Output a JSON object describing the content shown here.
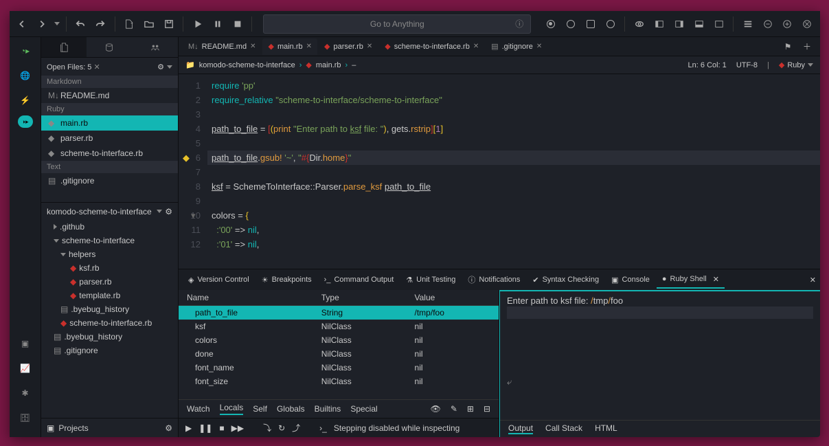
{
  "search_placeholder": "Go to Anything",
  "status": {
    "line_col": "Ln: 6 Col: 1",
    "encoding": "UTF-8",
    "language": "Ruby"
  },
  "tabs": [
    {
      "label": "README.md",
      "icon": "markdown"
    },
    {
      "label": "main.rb",
      "icon": "ruby",
      "active": true
    },
    {
      "label": "parser.rb",
      "icon": "ruby"
    },
    {
      "label": "scheme-to-interface.rb",
      "icon": "ruby"
    },
    {
      "label": ".gitignore",
      "icon": "file"
    }
  ],
  "breadcrumb": {
    "folder": "komodo-scheme-to-interface",
    "file": "main.rb"
  },
  "open_files": {
    "title": "Open Files: 5",
    "groups": [
      {
        "name": "Markdown",
        "items": [
          "README.md"
        ]
      },
      {
        "name": "Ruby",
        "items": [
          "main.rb",
          "parser.rb",
          "scheme-to-interface.rb"
        ]
      },
      {
        "name": "Text",
        "items": [
          ".gitignore"
        ]
      }
    ]
  },
  "project": {
    "name": "komodo-scheme-to-interface",
    "tree": [
      {
        "name": ".github",
        "type": "dir",
        "depth": 0
      },
      {
        "name": "scheme-to-interface",
        "type": "dir",
        "depth": 0,
        "open": true
      },
      {
        "name": "helpers",
        "type": "dir",
        "depth": 1,
        "open": true
      },
      {
        "name": "ksf.rb",
        "type": "ruby",
        "depth": 2
      },
      {
        "name": "parser.rb",
        "type": "ruby",
        "depth": 2
      },
      {
        "name": "template.rb",
        "type": "ruby",
        "depth": 2
      },
      {
        "name": ".byebug_history",
        "type": "file",
        "depth": 1
      },
      {
        "name": "scheme-to-interface.rb",
        "type": "ruby",
        "depth": 1
      },
      {
        "name": ".byebug_history",
        "type": "file",
        "depth": 0
      },
      {
        "name": ".gitignore",
        "type": "file",
        "depth": 0
      }
    ],
    "footer_label": "Projects"
  },
  "code": {
    "lines": [
      {
        "n": 1,
        "h": "<span class='c-kw'>require</span> <span class='c-str'>'pp'</span>"
      },
      {
        "n": 2,
        "h": "<span class='c-kw'>require_relative</span> <span class='c-str'>\"scheme-to-interface/scheme-to-interface\"</span>"
      },
      {
        "n": 3,
        "h": ""
      },
      {
        "n": 4,
        "h": "<span class='c-und'>path_to_file</span> <span class='c-punc'>=</span> <span class='c-red'>[</span><span class='c-sym'>(</span><span class='c-meth'>print</span> <span class='c-str'>\"Enter path to <span class='c-und'>ksf</span> file: \"</span><span class='c-sym'>)</span><span class='c-punc'>,</span> gets<span class='c-punc'>.</span><span class='c-meth'>rstrip</span><span class='c-red'>]</span><span class='c-sym'>[</span><span class='c-num'>1</span><span class='c-sym'>]</span>"
      },
      {
        "n": 5,
        "h": ""
      },
      {
        "n": 6,
        "hl": true,
        "bp": true,
        "h": "<span class='c-und'>path_to_file</span><span class='c-punc'>.</span><span class='c-meth'>gsub!</span> <span class='c-str'>'~'</span><span class='c-punc'>,</span> <span class='c-str'>\"</span><span class='c-red'>#{</span>Dir<span class='c-punc'>.</span><span class='c-meth'>home</span><span class='c-red'>}</span><span class='c-str'>\"</span>"
      },
      {
        "n": 7,
        "h": ""
      },
      {
        "n": 8,
        "h": "<span class='c-und'>ksf</span> <span class='c-punc'>=</span> SchemeToInterface<span class='c-punc'>::</span>Parser<span class='c-punc'>.</span><span class='c-meth'>parse_ksf</span> <span class='c-und'>path_to_file</span>"
      },
      {
        "n": 9,
        "h": ""
      },
      {
        "n": 10,
        "fold": true,
        "h": "colors <span class='c-punc'>=</span> <span class='c-sym'>{</span>"
      },
      {
        "n": 11,
        "h": "  <span class='c-str'>:'00'</span> <span class='c-punc'>=&gt;</span> <span class='c-kw'>nil</span><span class='c-punc'>,</span>"
      },
      {
        "n": 12,
        "h": "  <span class='c-str'>:'01'</span> <span class='c-punc'>=&gt;</span> <span class='c-kw'>nil</span><span class='c-punc'>,</span>"
      }
    ]
  },
  "panel_tabs": [
    "Version Control",
    "Breakpoints",
    "Command Output",
    "Unit Testing",
    "Notifications",
    "Syntax Checking",
    "Console",
    "Ruby Shell"
  ],
  "locals": {
    "headers": [
      "Name",
      "Type",
      "Value"
    ],
    "rows": [
      {
        "name": "path_to_file",
        "type": "String",
        "value": "/tmp/foo",
        "sel": true
      },
      {
        "name": "ksf",
        "type": "NilClass",
        "value": "nil"
      },
      {
        "name": "colors",
        "type": "NilClass",
        "value": "nil"
      },
      {
        "name": "done",
        "type": "NilClass",
        "value": "nil"
      },
      {
        "name": "font_name",
        "type": "NilClass",
        "value": "nil"
      },
      {
        "name": "font_size",
        "type": "NilClass",
        "value": "nil"
      }
    ],
    "subtabs": [
      "Watch",
      "Locals",
      "Self",
      "Globals",
      "Builtins",
      "Special"
    ],
    "active_subtab": "Locals"
  },
  "shell": {
    "prompt_text": "Enter path to ksf file: ",
    "input_text": "/tmp/foo",
    "subtabs": [
      "Output",
      "Call Stack",
      "HTML"
    ],
    "active_subtab": "Output"
  },
  "debug_status": "Stepping disabled while inspecting"
}
